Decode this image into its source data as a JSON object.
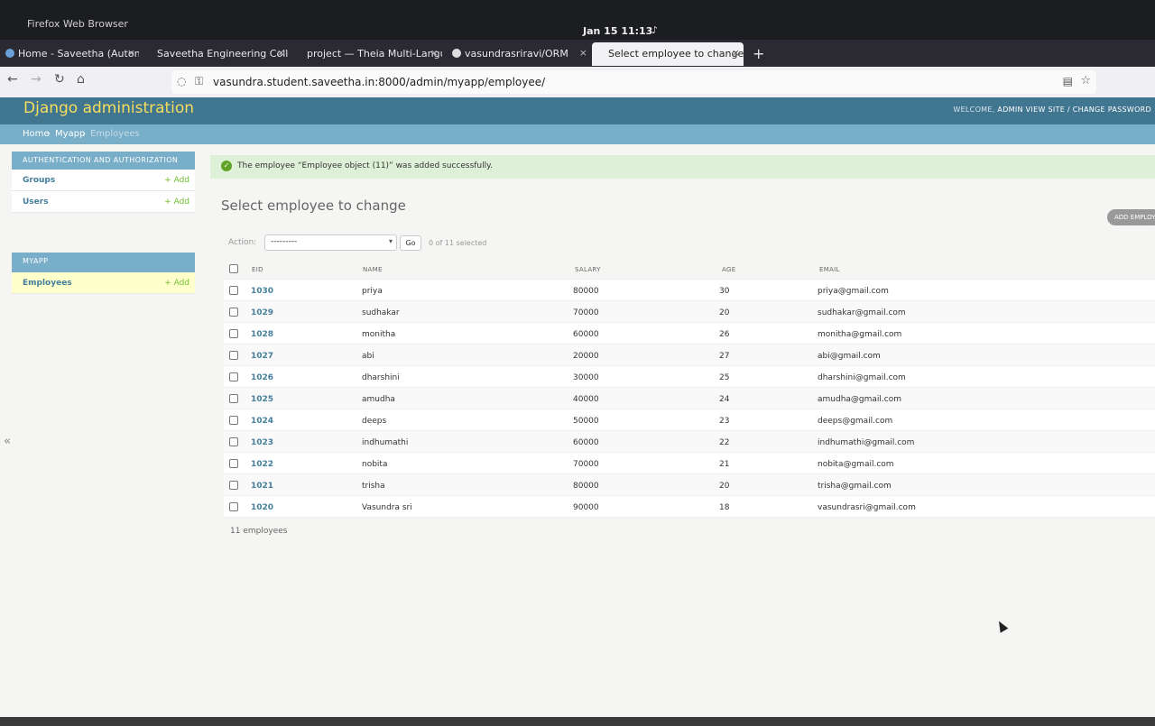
{
  "os_top_bar": {
    "app_name": "Firefox Web Browser",
    "clock": "Jan 15  11:13"
  },
  "browser": {
    "tabs": [
      {
        "label": "Home - Saveetha (Autono",
        "active": false
      },
      {
        "label": "Saveetha Engineering Colle",
        "active": false
      },
      {
        "label": "project — Theia Multi-Langu",
        "active": false
      },
      {
        "label": "vasundrasriravi/ORM",
        "active": false
      },
      {
        "label": "Select employee to change |",
        "active": true
      }
    ],
    "url": "vasundra.student.saveetha.in:8000/admin/myapp/employee/"
  },
  "admin": {
    "brand": "Django administration",
    "user_tools": {
      "welcome": "WELCOME, ",
      "user": "ADMIN",
      "view_site": "VIEW SITE",
      "sep": " / ",
      "change_password": "CHANGE PASSWORD"
    },
    "breadcrumbs": {
      "home": "Home",
      "sep1": " › ",
      "app": "Myapp",
      "sep2": " › ",
      "current": "Employees"
    },
    "sidebar": {
      "auth_caption": "AUTHENTICATION AND AUTHORIZATION",
      "groups": "Groups",
      "users": "Users",
      "myapp_caption": "MYAPP",
      "employees": "Employees",
      "add_label": "+ Add",
      "collapse": "«"
    },
    "message": "The employee “Employee object (11)” was added successfully.",
    "title": "Select employee to change",
    "add_button": "ADD EMPLOYEE",
    "action": {
      "label": "Action:",
      "selected": "---------",
      "go": "Go",
      "count": "0 of 11 selected"
    },
    "columns": {
      "eid": "EID",
      "name": "NAME",
      "salary": "SALARY",
      "age": "AGE",
      "email": "EMAIL"
    },
    "rows": [
      {
        "eid": "1030",
        "name": "priya",
        "salary": "80000",
        "age": "30",
        "email": "priya@gmail.com"
      },
      {
        "eid": "1029",
        "name": "sudhakar",
        "salary": "70000",
        "age": "20",
        "email": "sudhakar@gmail.com"
      },
      {
        "eid": "1028",
        "name": "monitha",
        "salary": "60000",
        "age": "26",
        "email": "monitha@gmail.com"
      },
      {
        "eid": "1027",
        "name": "abi",
        "salary": "20000",
        "age": "27",
        "email": "abi@gmail.com"
      },
      {
        "eid": "1026",
        "name": "dharshini",
        "salary": "30000",
        "age": "25",
        "email": "dharshini@gmail.com"
      },
      {
        "eid": "1025",
        "name": "amudha",
        "salary": "40000",
        "age": "24",
        "email": "amudha@gmail.com"
      },
      {
        "eid": "1024",
        "name": "deeps",
        "salary": "50000",
        "age": "23",
        "email": "deeps@gmail.com"
      },
      {
        "eid": "1023",
        "name": "indhumathi",
        "salary": "60000",
        "age": "22",
        "email": "indhumathi@gmail.com"
      },
      {
        "eid": "1022",
        "name": "nobita",
        "salary": "70000",
        "age": "21",
        "email": "nobita@gmail.com"
      },
      {
        "eid": "1021",
        "name": "trisha",
        "salary": "80000",
        "age": "20",
        "email": "trisha@gmail.com"
      },
      {
        "eid": "1020",
        "name": "Vasundra sri",
        "salary": "90000",
        "age": "18",
        "email": "vasundrasri@gmail.com"
      }
    ],
    "paginator": "11 employees"
  }
}
